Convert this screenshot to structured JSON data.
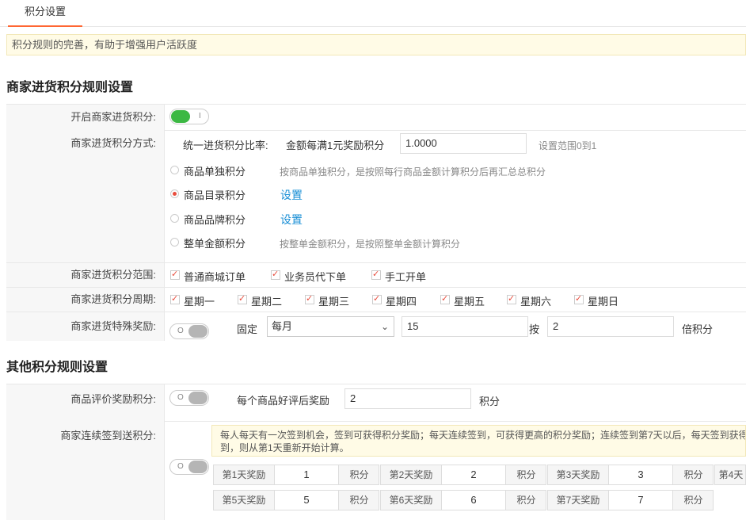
{
  "tabs": [
    "积分设置"
  ],
  "notice": "积分规则的完善，有助于增强用户活跃度",
  "section1": {
    "title": "商家进货积分规则设置",
    "enable_label": "开启商家进货积分:",
    "enable_toggle_mark": "I",
    "method_label": "商家进货积分方式:",
    "unified_label": "统一进货积分比率:",
    "per_yuan_label": "金额每满1元奖励积分",
    "ratio_value": "1.0000",
    "ratio_hint": "设置范围0到1",
    "options": [
      {
        "label": "商品单独积分",
        "hint": "按商品单独积分，是按照每行商品金额计算积分后再汇总总积分",
        "link": ""
      },
      {
        "label": "商品目录积分",
        "hint": "",
        "link": "设置"
      },
      {
        "label": "商品品牌积分",
        "hint": "",
        "link": "设置"
      },
      {
        "label": "整单金额积分",
        "hint": "按整单金额积分，是按照整单金额计算积分",
        "link": ""
      }
    ],
    "selected_option": "商品目录积分",
    "scope_label": "商家进货积分范围:",
    "scope": [
      "普通商城订单",
      "业务员代下单",
      "手工开单"
    ],
    "cycle_label": "商家进货积分周期:",
    "weekdays": [
      "星期一",
      "星期二",
      "星期三",
      "星期四",
      "星期五",
      "星期六",
      "星期日"
    ],
    "special_label": "商家进货特殊奖励:",
    "special_toggle_mark": "O",
    "fixed_label": "固定",
    "period_value": "每月",
    "day_value": "15",
    "by_label": "按",
    "multiplier_value": "2",
    "times_unit": "倍积分"
  },
  "section2": {
    "title": "其他积分规则设置",
    "review_label": "商品评价奖励积分:",
    "review_toggle_mark": "O",
    "review_text": "每个商品好评后奖励",
    "review_value": "2",
    "review_unit": "积分",
    "signin_label": "商家连续签到送积分:",
    "signin_toggle_mark": "O",
    "signin_info_line1": "每人每天有一次签到机会，签到可获得积分奖励；每天连续签到，可获得更高的积分奖励；连续签到第7天以后，每天签到获得",
    "signin_info_line2": "到，则从第1天重新开始计算。",
    "days": [
      {
        "label": "第1天奖励",
        "value": "1",
        "unit": "积分"
      },
      {
        "label": "第2天奖励",
        "value": "2",
        "unit": "积分"
      },
      {
        "label": "第3天奖励",
        "value": "3",
        "unit": "积分"
      },
      {
        "label": "第4天",
        "value": "",
        "unit": ""
      },
      {
        "label": "第5天奖励",
        "value": "5",
        "unit": "积分"
      },
      {
        "label": "第6天奖励",
        "value": "6",
        "unit": "积分"
      },
      {
        "label": "第7天奖励",
        "value": "7",
        "unit": "积分"
      }
    ]
  },
  "colors": {
    "accent": "#ff6633",
    "toggle_on": "#3cb843",
    "link": "#1a8fd6",
    "check": "#e84c3d",
    "notice_bg": "#fffbe6"
  }
}
